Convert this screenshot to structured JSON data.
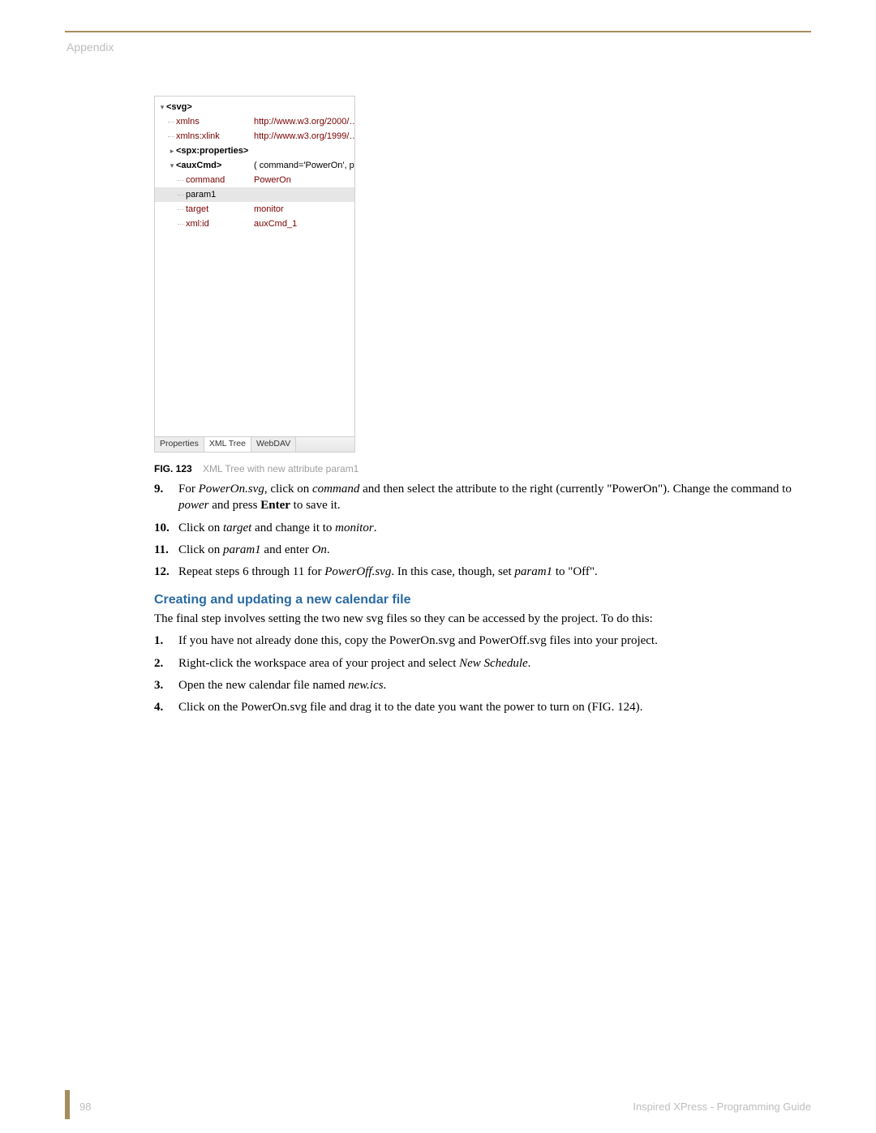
{
  "header": {
    "label": "Appendix"
  },
  "screenshot": {
    "tree": {
      "root": "<svg>",
      "rows": [
        {
          "k": "xmlns",
          "v": "http://www.w3.org/2000/…"
        },
        {
          "k": "xmlns:xlink",
          "v": "http://www.w3.org/1999/…"
        },
        {
          "k": "<spx:properties>",
          "v": ""
        },
        {
          "k": "<auxCmd>",
          "v": "( command='PowerOn', p …"
        },
        {
          "k": "command",
          "v": "PowerOn"
        },
        {
          "k": "param1",
          "v": ""
        },
        {
          "k": "target",
          "v": "monitor"
        },
        {
          "k": "xml:id",
          "v": "auxCmd_1"
        }
      ]
    },
    "tabs": {
      "a": "Properties",
      "b": "XML Tree",
      "c": "WebDAV"
    }
  },
  "figure": {
    "num": "FIG. 123",
    "caption": "XML Tree with new attribute param1"
  },
  "steps1": [
    {
      "n": "9.",
      "parts": [
        {
          "t": "For "
        },
        {
          "t": "PowerOn.svg",
          "i": true
        },
        {
          "t": ", click on "
        },
        {
          "t": "command",
          "i": true
        },
        {
          "t": " and then select the attribute to the right (currently \"PowerOn\"). Change the command to "
        },
        {
          "t": "power",
          "i": true
        },
        {
          "t": " and press "
        },
        {
          "t": "Enter",
          "b": true
        },
        {
          "t": " to save it."
        }
      ]
    },
    {
      "n": "10.",
      "parts": [
        {
          "t": "Click on "
        },
        {
          "t": "target",
          "i": true
        },
        {
          "t": " and change it to "
        },
        {
          "t": "monitor",
          "i": true
        },
        {
          "t": "."
        }
      ]
    },
    {
      "n": "11.",
      "parts": [
        {
          "t": "Click on "
        },
        {
          "t": "param1",
          "i": true
        },
        {
          "t": " and enter "
        },
        {
          "t": "On",
          "i": true
        },
        {
          "t": "."
        }
      ]
    },
    {
      "n": "12.",
      "parts": [
        {
          "t": "Repeat steps 6 through 11 for "
        },
        {
          "t": "PowerOff.svg",
          "i": true
        },
        {
          "t": ". In this case, though, set "
        },
        {
          "t": "param1",
          "i": true
        },
        {
          "t": " to \"Off\"."
        }
      ]
    }
  ],
  "section": {
    "heading": "Creating and updating a new calendar file",
    "intro": "The final step involves setting the two new svg files so they can be accessed by the project. To do this:",
    "steps": [
      {
        "n": "1.",
        "parts": [
          {
            "t": "If you have not already done this, copy the PowerOn.svg and PowerOff.svg files into your project."
          }
        ]
      },
      {
        "n": "2.",
        "parts": [
          {
            "t": "Right-click the workspace area of your project and select "
          },
          {
            "t": "New Schedule",
            "i": true
          },
          {
            "t": "."
          }
        ]
      },
      {
        "n": "3.",
        "parts": [
          {
            "t": "Open the new calendar file named "
          },
          {
            "t": "new.ics",
            "i": true
          },
          {
            "t": "."
          }
        ]
      },
      {
        "n": "4.",
        "parts": [
          {
            "t": "Click on the PowerOn.svg file and drag it to the date you want the power to turn on (FIG. 124)."
          }
        ]
      }
    ]
  },
  "footer": {
    "page": "98",
    "title": "Inspired XPress - Programming Guide"
  }
}
